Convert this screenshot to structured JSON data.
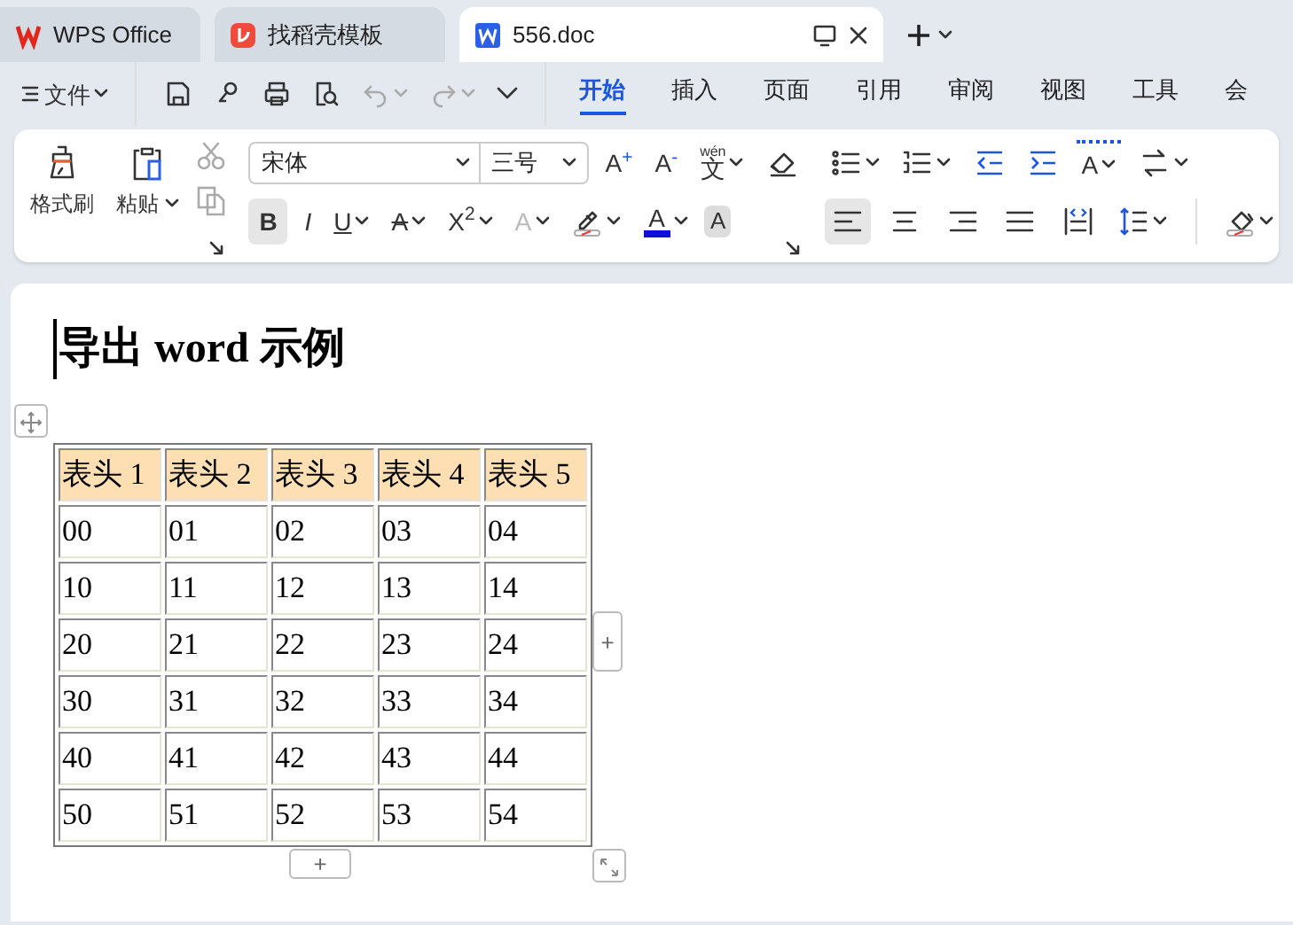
{
  "tabs": [
    {
      "label": "WPS Office",
      "kind": "home",
      "selected": false
    },
    {
      "label": "找稻壳模板",
      "kind": "store",
      "selected": false
    },
    {
      "label": "556.doc",
      "kind": "doc",
      "selected": true
    }
  ],
  "menu": {
    "file": "文件",
    "ribbon_tabs": [
      {
        "label": "开始",
        "selected": true
      },
      {
        "label": "插入",
        "selected": false
      },
      {
        "label": "页面",
        "selected": false
      },
      {
        "label": "引用",
        "selected": false
      },
      {
        "label": "审阅",
        "selected": false
      },
      {
        "label": "视图",
        "selected": false
      },
      {
        "label": "工具",
        "selected": false
      },
      {
        "label": "会",
        "selected": false
      }
    ]
  },
  "ribbon": {
    "clipboard": [
      {
        "label": "格式刷",
        "dropdown": false
      },
      {
        "label": "粘贴",
        "dropdown": true
      }
    ],
    "font_name": "宋体",
    "font_size": "三号",
    "font_row1": [
      {
        "label": "A$^{+}$",
        "dropdown": false
      },
      {
        "label": "A$^{-}$",
        "dropdown": false
      },
      {
        "label": "文",
        "ruby": "wén",
        "dropdown": true
      }
    ],
    "font_row2": [
      {
        "label": "B",
        "selected": true,
        "dropdown": false
      },
      {
        "label": "I",
        "selected": false,
        "dropdown": false
      },
      {
        "label": "U",
        "selected": false,
        "dropdown": true
      },
      {
        "label": "A",
        "selected": false,
        "dropdown": true
      },
      {
        "label": "X$^{2}$",
        "selected": false,
        "dropdown": true
      },
      {
        "label": "A",
        "selected": false,
        "dropdown": true
      }
    ],
    "font_color_label": "A",
    "shading_label": "A",
    "spacing_label": "A",
    "align": [
      {
        "selected": true
      },
      {
        "selected": false
      },
      {
        "selected": false
      },
      {
        "selected": false
      },
      {
        "selected": false
      }
    ]
  },
  "document": {
    "heading": "导出 word 示例",
    "table": {
      "columns": [
        "表头 1",
        "表头 2",
        "表头 3",
        "表头 4",
        "表头 5"
      ],
      "rows": [
        [
          "00",
          "01",
          "02",
          "03",
          "04"
        ],
        [
          "10",
          "11",
          "12",
          "13",
          "14"
        ],
        [
          "20",
          "21",
          "22",
          "23",
          "24"
        ],
        [
          "30",
          "31",
          "32",
          "33",
          "34"
        ],
        [
          "40",
          "41",
          "42",
          "43",
          "44"
        ],
        [
          "50",
          "51",
          "52",
          "53",
          "54"
        ]
      ]
    },
    "add_column": "+",
    "add_row": "+"
  }
}
